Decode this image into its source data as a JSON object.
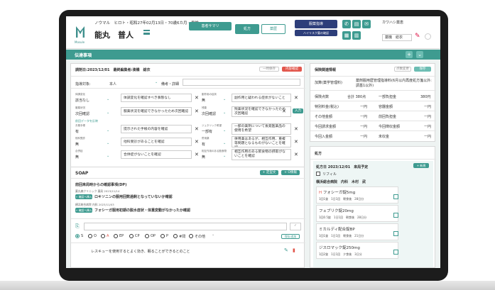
{
  "header": {
    "logo_text": "Mosule",
    "patient_info": "ノウマル　ヒロト・昭和27年02月13日・70歳6カ月・男性",
    "patient_name": "能丸　普人",
    "btn_summary": "患者サマリ",
    "tab_prescription": "処方",
    "tab_history": "薬歴",
    "btn_guidance": "服薬指導",
    "btn_high_risk": "ハイリスク薬の確認",
    "staff_kana": "カワハシ薬恵",
    "staff_name": "薬機　総衣"
  },
  "notice_bar": {
    "title": "伝達事項",
    "add": "+",
    "chevron": "⌄"
  },
  "record": {
    "title": "調剤日:2023/12/01　最終編集者:湊橋　総衣",
    "btn_temp_save": "一時保存",
    "btn_record": "内容確認",
    "guidance_target_label": "指導対象:",
    "guidance_target_value": "本人",
    "remarks_label": "備考・詳細",
    "rows": [
      {
        "left_label": "体調変化",
        "left_value": "該当なし",
        "left_text": "体調変化を確認すべき事態なし",
        "right_label": "副作用の症状",
        "right_value": "無",
        "right_text": "副作用と疑われる症状がないことを確認"
      },
      {
        "left_label": "服薬状況",
        "left_value": "次回確認",
        "left_text": "服薬状況を確認できなかったため次回確認",
        "right_label": "残薬",
        "right_value": "次回確認",
        "right_text": "残薬状況を確認できなかったため次回確認"
      },
      {
        "left_label": "お薬手帳",
        "left_value": "有",
        "left_text": "提示された手帳の内容を確認",
        "right_label": "ジェネリック希望",
        "right_value": "一部有",
        "right_text": "一部の薬剤について後発医薬品の使用を希望"
      },
      {
        "left_label": "他科受診",
        "left_value": "無",
        "left_text": "他科受診があることを確認",
        "right_label": "併用薬",
        "right_value": "有",
        "right_text": "併用薬はあるが、相互作用、重複等問題となるものがないことを確認"
      },
      {
        "left_label": "合併症",
        "left_value": "無",
        "left_text": "合併症がないことを確認",
        "right_label": "相互作用のある飲食物",
        "right_value": "無",
        "right_text": "相互作用のある飲食物の摂取がないことを確認"
      }
    ],
    "btn_input": "入力",
    "prev_data_link": "前回データを反映"
  },
  "soap": {
    "title": "SOAP",
    "btn_template": "+ 定型文",
    "btn_other": "+ O情報",
    "entry_title": "前回来局時からの確認事項(DP)",
    "entry1_meta": "薬丸森クリニック 薬局 2023/11/14",
    "entry1_btn": "+ 確認へ挿入",
    "entry1_text": "ロキソニンの服用回数過剰となっていないか確認",
    "entry2_meta": "横浜総合病院 内科 2023/11/03",
    "entry2_btn": "+ 確認へ挿入",
    "entry2_text": "フォシーガ服用初期の脱水症状・体重変動がなかったか確認",
    "radio": [
      "S",
      "O",
      "A",
      "EP",
      "CP",
      "OP",
      "P",
      "#問",
      "その他"
    ],
    "btn_register": "保存/追加",
    "bottom_text": "レスキューを使用するとよく効き、眠ることができるとのこと"
  },
  "insurance": {
    "title": "保険関連情報",
    "btn_detail": "点数変更",
    "btn_save": "保存",
    "fee_label": "加算(薬学管理料)",
    "fee_value": "薬剤服用歴管理指導料(6月以内再度処方箋以外:調基1以外)",
    "rows": [
      [
        "保険点数",
        "合計 380点",
        "一部負担金",
        "380円"
      ],
      [
        "特別料金(税込)",
        "ー円",
        "容器金額",
        "ー円"
      ],
      [
        "その他金額",
        "ー円",
        "前回負担金",
        "ー円"
      ],
      [
        "今回請求金額",
        "ー円",
        "今回徴収金額",
        "ー円"
      ],
      [
        "今回入金額",
        "ー円",
        "未収金",
        "ー円"
      ]
    ]
  },
  "rx": {
    "title": "処方",
    "date": "処方日 2023/12/01　来局予定",
    "btn_new": "+ 新規",
    "refill": "リフィル",
    "hospital": "横浜総合病院　内科　木村　武",
    "drugs": [
      {
        "name": "フォシーガ錠5mg",
        "dose": "1回1錠　1日1回　朝食後　28日分",
        "mark": "H"
      },
      {
        "name": "フェブリク錠20mg",
        "dose": "1回0.5錠　1日1回　朝食後　28日分",
        "mark": ""
      },
      {
        "name": "ミカルディ配合錠BP",
        "dose": "1回1錠　1日1回　朝食後　21日分",
        "mark": ""
      },
      {
        "name": "ジスロマック錠250mg",
        "dose": "1回2錠　1日1回　夕食後　3日分",
        "mark": ""
      }
    ]
  }
}
